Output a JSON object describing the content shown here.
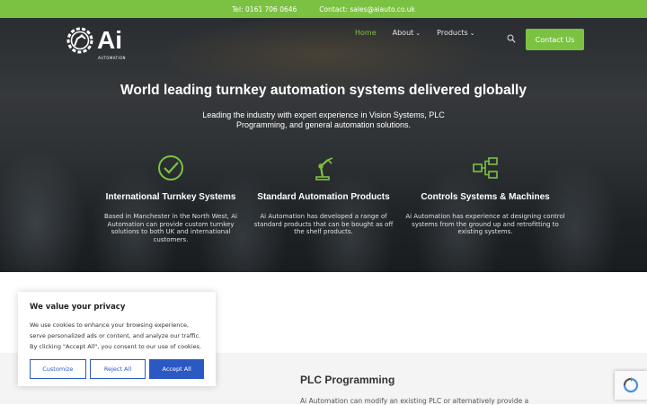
{
  "topbar": {
    "phone": "Tel: 0161 706 0646",
    "email": "Contact: sales@aiauto.co.uk"
  },
  "logo": {
    "text": "Ai",
    "subtext": "AUTOMATION"
  },
  "nav": {
    "items": [
      {
        "label": "Home"
      },
      {
        "label": "About"
      },
      {
        "label": "Products"
      }
    ],
    "contact_label": "Contact Us"
  },
  "hero": {
    "title": "World leading turnkey automation systems delivered globally",
    "subtitle": "Leading the industry with expert experience in Vision Systems, PLC Programming, and general automation solutions."
  },
  "features": [
    {
      "icon": "check-circle-icon",
      "title": "International Turnkey Systems",
      "body": "Based in Manchester in the North West, Ai Automation can provide custom turnkey solutions to both UK and international customers."
    },
    {
      "icon": "robot-arm-icon",
      "title": "Standard Automation Products",
      "body": "Ai Automation has developed a range of standard products that can be bought as off the shelf products."
    },
    {
      "icon": "flowchart-icon",
      "title": "Controls Systems & Machines",
      "body": "Ai Automation has experience at designing control systems from the ground up and retrofitting to existing systems."
    }
  ],
  "cookie": {
    "title": "We value your privacy",
    "text": "We use cookies to enhance your browsing experience, serve personalized ads or content, and analyze our traffic. By clicking \"Accept All\", you consent to our use of cookies.",
    "customize": "Customize",
    "reject": "Reject All",
    "accept": "Accept All"
  },
  "section": {
    "title": "PLC Programming",
    "body": "Ai Automation can modify an existing PLC or alternatively provide a"
  },
  "colors": {
    "brand": "#7cc242",
    "cookie_accent": "#2b59c3"
  }
}
